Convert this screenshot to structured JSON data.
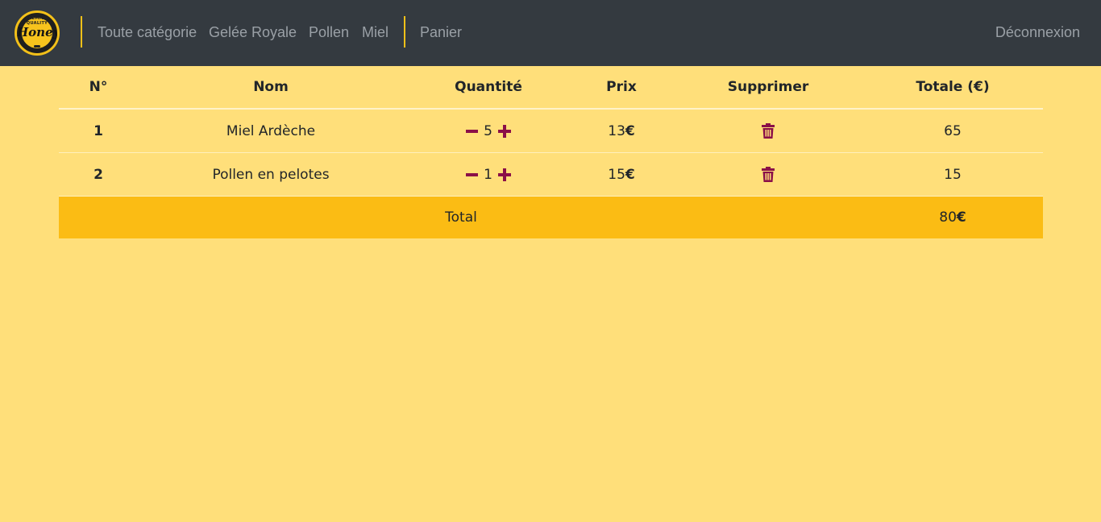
{
  "logo": {
    "top_text": "PREMIUM QUALITY",
    "brand": "Honey"
  },
  "nav": {
    "links": [
      "Toute catégorie",
      "Gelée Royale",
      "Pollen",
      "Miel"
    ],
    "cart": "Panier",
    "logout": "Déconnexion"
  },
  "table": {
    "headers": [
      "N°",
      "Nom",
      "Quantité",
      "Prix",
      "Supprimer",
      "Totale (€)"
    ],
    "rows": [
      {
        "num": "1",
        "name": "Miel Ardèche",
        "qty": "5",
        "price": "13",
        "total": "65"
      },
      {
        "num": "2",
        "name": "Pollen en pelotes",
        "qty": "1",
        "price": "15",
        "total": "15"
      }
    ],
    "total_label": "Total",
    "total_value": "80",
    "currency": "€"
  },
  "icons": {
    "minus": "minus-icon",
    "plus": "plus-icon",
    "delete": "trash-icon"
  },
  "colors": {
    "navbar": "#343a40",
    "background": "#ffdf7a",
    "total_row": "#fbbc14",
    "accent": "#8b1048",
    "separator": "#f3c019"
  }
}
